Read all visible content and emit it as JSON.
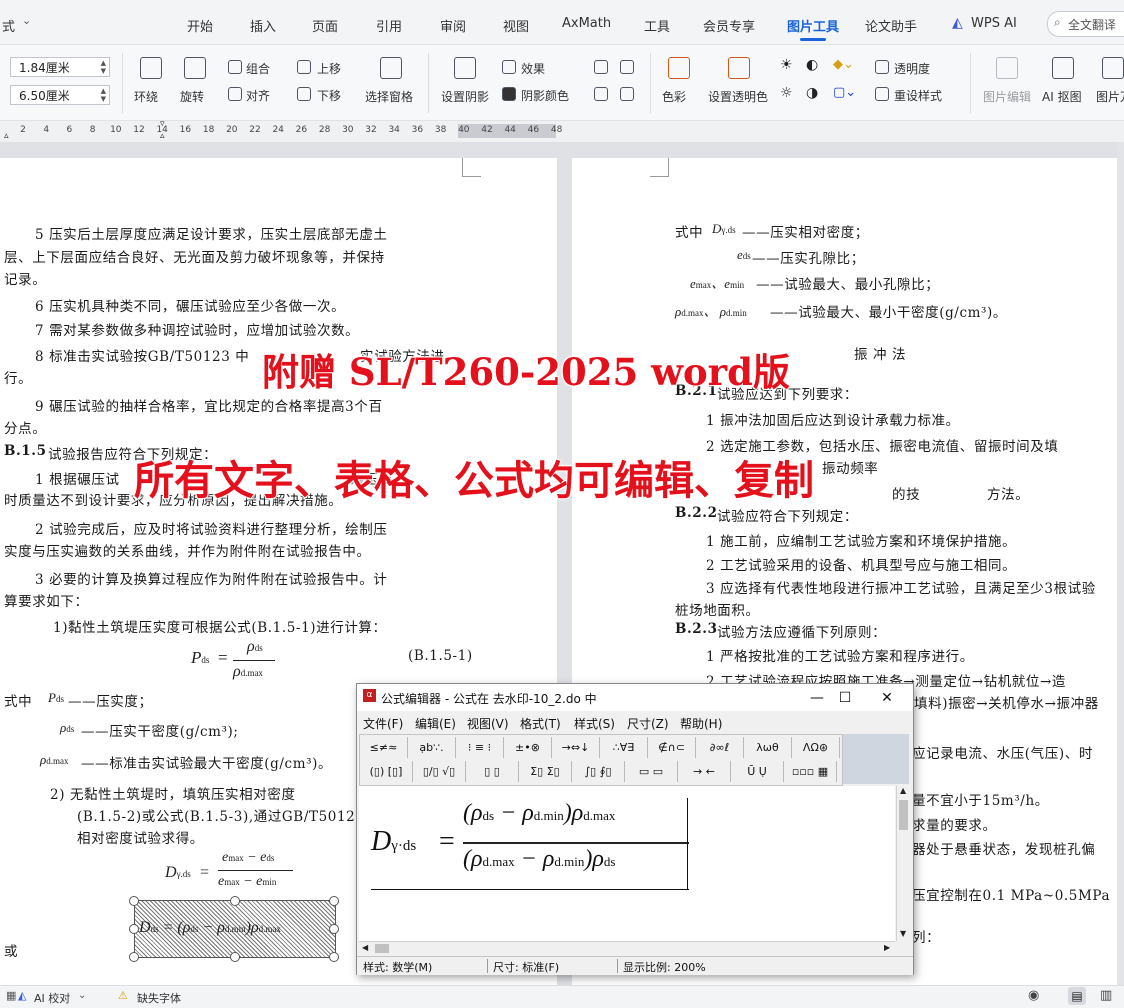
{
  "menubar": {
    "left_fragment": "式",
    "tabs": [
      "开始",
      "插入",
      "页面",
      "引用",
      "审阅",
      "视图",
      "AxMath",
      "工具",
      "会员专享",
      "图片工具",
      "论文助手"
    ],
    "active_tab": "图片工具",
    "wps_ai": "WPS AI",
    "search_placeholder": "全文翻译"
  },
  "ribbon": {
    "height_value": "1.84厘米",
    "width_value": "6.50厘米",
    "wrap": "环绕",
    "rotate": "旋转",
    "group": "组合",
    "align": "对齐",
    "bring_forward": "上移",
    "send_backward": "下移",
    "selection_pane": "选择窗格",
    "set_shadow": "设置阴影",
    "effects": "效果",
    "shadow_color": "阴影颜色",
    "color": "色彩",
    "set_transparent": "设置透明色",
    "transparency": "透明度",
    "reset_style": "重设样式",
    "picture_edit": "图片编辑",
    "ai_cutout": "AI 抠图",
    "picture_extra": "图片万"
  },
  "ruler": {
    "ticks": [
      "2",
      "4",
      "6",
      "8",
      "10",
      "12",
      "14",
      "16",
      "18",
      "20",
      "22",
      "24",
      "26",
      "28",
      "30",
      "32",
      "34",
      "36",
      "38",
      "40",
      "42",
      "44",
      "46",
      "48"
    ]
  },
  "left_page": {
    "p1a": "5 压实后土层厚度应满足设计要求，压实土层底部无虚土",
    "p1b": "层、上下层面应结合良好、无光面及剪力破坏现象等，并保持",
    "p1c": "记录。",
    "p2": "6 压实机具种类不同，碾压试验应至少各做一次。",
    "p3": "7 需对某参数做多种调控试验时，应增加试验次数。",
    "p4a": "8 标准击实试验按GB/T50123 中",
    "p4a_tail": "实试验方法进",
    "p4b": "行。",
    "p5a": "9 碾压试验的抽样合格率，宜比规定的合格率提高3个百",
    "p5b": "分点。",
    "h_b15": "B.1.5",
    "h_b15_text": "试验报告应符合下列规定：",
    "p6a": "1 根据碾压试",
    "p6a_tail": "碾压参",
    "p6b": "时质量达不到设计要求，应分析原因，提出解决措施。",
    "p7a": "2 试验完成后，应及时将试验资料进行整理分析，绘制压",
    "p7b": "实度与压实遍数的关系曲线，并作为附件附在试验报告中。",
    "p8a": "3 必要的计算及换算过程应作为附件附在试验报告中。计",
    "p8b": "算要求如下：",
    "p9": "1)黏性土筑堤压实度可根据公式(B.1.5-1)进行计算：",
    "eq1_label": "(B.1.5-1)",
    "where": "式中",
    "def1": "——压实度；",
    "def2": "——压实干密度(g/cm³);",
    "def3": "——标准击实试验最大干密度(g/cm³)。",
    "p10a": "2) 无黏性土筑堤时，填筑压实相对密度",
    "p10b": "(B.1.5-2)或公式(B.1.5-3),通过GB/T50123规",
    "p10c": "相对密度试验求得。",
    "or": "或"
  },
  "right_page": {
    "where": "式中",
    "def1": "——压实相对密度；",
    "def2": "——压实孔隙比；",
    "def3": "——试验最大、最小孔隙比；",
    "def4": "——试验最大、最小干密度(g/cm³)。",
    "section": "振 冲 法",
    "h_b21": "B.2.1",
    "h_b21_text": "试验应达到下列要求：",
    "r1": "1 振冲法加固后应达到设计承载力标准。",
    "r2a": "2 选定施工参数，包括水压、振密电流值、留振时间及填",
    "r2b": "振动频率",
    "r3": "的技",
    "r3_tail": "方法。",
    "h_b22": "B.2.2",
    "h_b22_text": "试验应符合下列规定：",
    "r4": "1 施工前，应编制工艺试验方案和环境保护措施。",
    "r5": "2 工艺试验采用的设备、机具型号应与施工相同。",
    "r6a": "3 应选择有代表性地段进行振冲工艺试验，且满足至少3根试验",
    "r6b": "桩场地面积。",
    "h_b23": "B.2.3",
    "h_b23_text": "试验方法应遵循下列原则：",
    "r7": "1 严格按批准的工艺试验方案和程序进行。",
    "r8a": "2 工艺试验流程应按照施工准备→测量定位→钻机就位→造",
    "r8b": "填料)振密→关机停水→振冲器",
    "r9": "应记录电流、水压(气压)、时",
    "r10": "量不宜小于15m³/h。",
    "r11": "求量的要求。",
    "r12": "器处于悬垂状态，发现桩孔偏",
    "r13": "压宜控制在0.1 MPa~0.5MPa",
    "r14": "列："
  },
  "watermark": {
    "line1": "附赠 SL/T260-2025 word版",
    "line2": "所有文字、表格、公式均可编辑、复制"
  },
  "equation_editor": {
    "title": "公式编辑器 - 公式在 去水印-10_2.do 中",
    "menus": [
      "文件(F)",
      "编辑(E)",
      "视图(V)",
      "格式(T)",
      "样式(S)",
      "尺寸(Z)",
      "帮助(H)"
    ],
    "palette_row1": [
      "≤≠≈",
      "ạb∵.",
      "⁝ ≡ ⁝",
      "±•⊗",
      "→⇔↓",
      "∴∀∃",
      "∉∩⊂",
      "∂∞ℓ",
      "λωθ",
      "ΛΩ⊛"
    ],
    "palette_row2": [
      "(▯) [▯]",
      "▯/▯ √▯",
      "▯ ▯",
      "Σ▯ Σ▯",
      "∫▯ ∮▯",
      "▭ ▭",
      "→ ←",
      "Ū Ụ",
      "▫▫▫ ▦"
    ],
    "status_style": "样式: 数学(M)",
    "status_size": "尺寸: 标准(F)",
    "status_zoom": "显示比例: 200%"
  },
  "statusbar": {
    "ai_check": "AI 校对",
    "missing_font": "缺失字体"
  }
}
